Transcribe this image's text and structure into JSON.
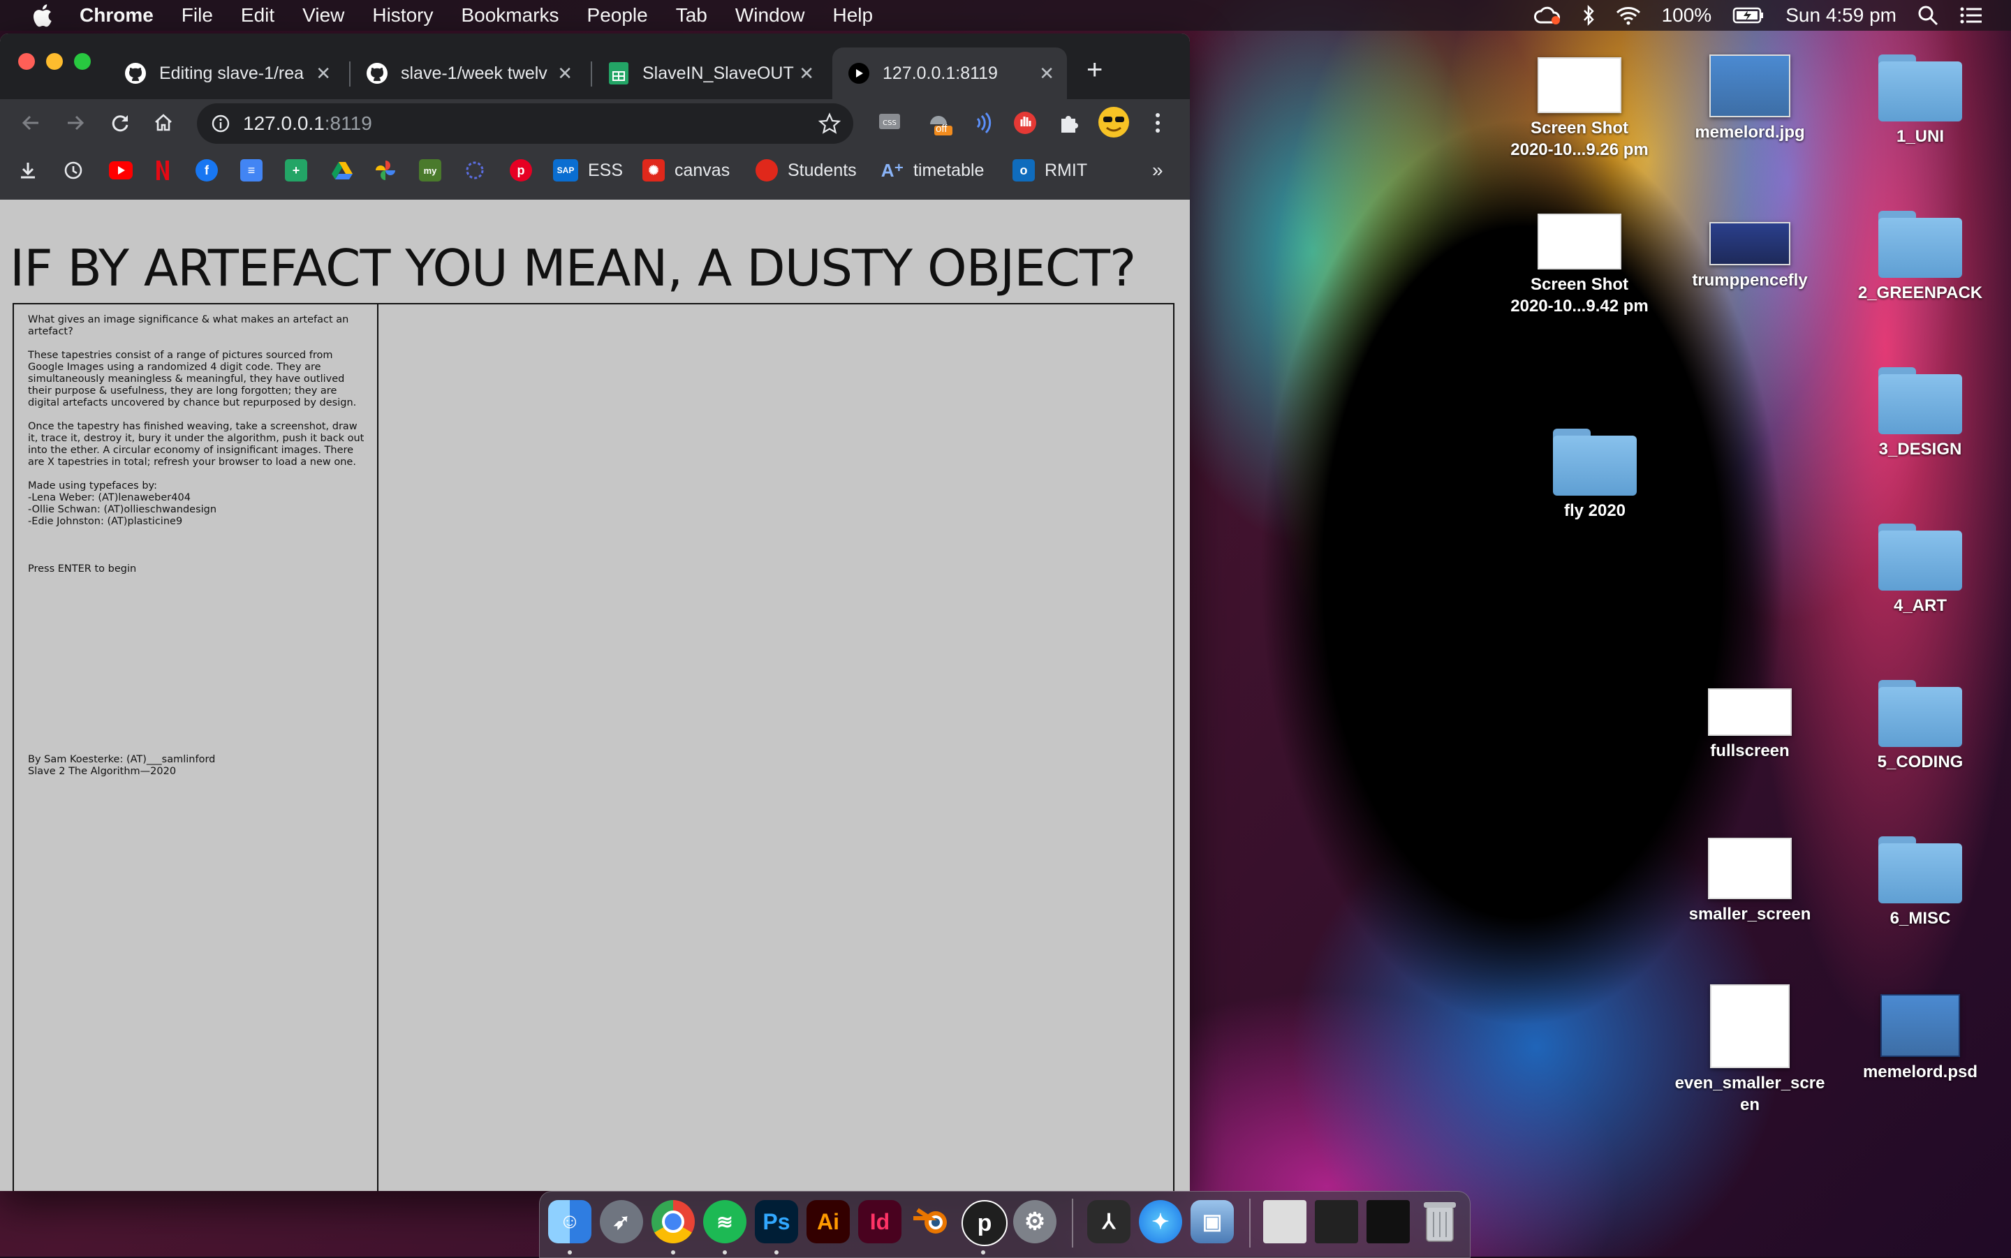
{
  "menubar": {
    "app_name": "Chrome",
    "items": [
      "File",
      "Edit",
      "View",
      "History",
      "Bookmarks",
      "People",
      "Tab",
      "Window",
      "Help"
    ],
    "battery": "100%",
    "clock": "Sun 4:59 pm"
  },
  "browser": {
    "tabs": [
      {
        "title": "Editing slave-1/rea",
        "icon": "github-icon"
      },
      {
        "title": "slave-1/week twelv",
        "icon": "github-icon"
      },
      {
        "title": "SlaveIN_SlaveOUT",
        "icon": "sheets-icon"
      },
      {
        "title": "127.0.0.1:8119",
        "icon": "play-icon"
      }
    ],
    "address": {
      "host": "127.0.0.1",
      "port": ":8119"
    },
    "bookmarks": [
      {
        "label": "ESS"
      },
      {
        "label": "canvas"
      },
      {
        "label": "Students"
      },
      {
        "label": "timetable"
      },
      {
        "label": "RMIT"
      }
    ],
    "ext_off_badge": "off",
    "overflow": "»"
  },
  "page": {
    "headline": "IF BY ARTEFACT YOU MEAN, A DUSTY OBJECT?",
    "intro_question": "What gives an image significance & what makes an artefact an artefact?",
    "intro_p1": "These tapestries consist of a range of pictures sourced from Google Images using a randomized 4 digit code. They are simultaneously meaningless & meaningful, they have outlived their purpose & usefulness, they are long forgotten; they are digital artefacts uncovered by chance but repurposed by design.",
    "intro_p2": "Once the tapestry has finished weaving, take a screenshot, draw it, trace it, destroy it, bury it under the algorithm, push it back out into the ether. A circular economy of insignificant images. There are X tapestries in total; refresh your browser to load a new one.",
    "typefaces_heading": "Made using typefaces by:",
    "typefaces": [
      "-Lena Weber: (AT)lenaweber404",
      "-Ollie Schwan: (AT)ollieschwandesign",
      "-Edie Johnston: (AT)plasticine9"
    ],
    "prompt": "Press ENTER to begin",
    "credit_1": "By Sam Koesterke: (AT)___samlinford",
    "credit_2": "Slave 2 The Algorithm—2020"
  },
  "desktop": {
    "icons": [
      {
        "label": "Screen Shot\n2020-10...9.26 pm"
      },
      {
        "label": "memelord.jpg"
      },
      {
        "label": "1_UNI"
      },
      {
        "label": "Screen Shot\n2020-10...9.42 pm"
      },
      {
        "label": "trumppencefly"
      },
      {
        "label": "2_GREENPACK"
      },
      {
        "label": "3_DESIGN"
      },
      {
        "label": "fly 2020"
      },
      {
        "label": "4_ART"
      },
      {
        "label": "fullscreen"
      },
      {
        "label": "5_CODING"
      },
      {
        "label": "smaller_screen"
      },
      {
        "label": "6_MISC"
      },
      {
        "label": "even_smaller_scre\nen"
      },
      {
        "label": "memelord.psd"
      }
    ]
  },
  "dock": {
    "apps": [
      "Finder",
      "Launchpad",
      "Chrome",
      "Spotify",
      "Ps",
      "Ai",
      "Id",
      "Blender",
      "Processing",
      "System Preferences",
      "Acrobat",
      "Safari",
      "Preview"
    ]
  },
  "colors": {
    "page_bg": "#c6c6c6",
    "chrome_dark": "#202124",
    "chrome_tab": "#35363a",
    "folder_blue": "#6fa8d8"
  }
}
